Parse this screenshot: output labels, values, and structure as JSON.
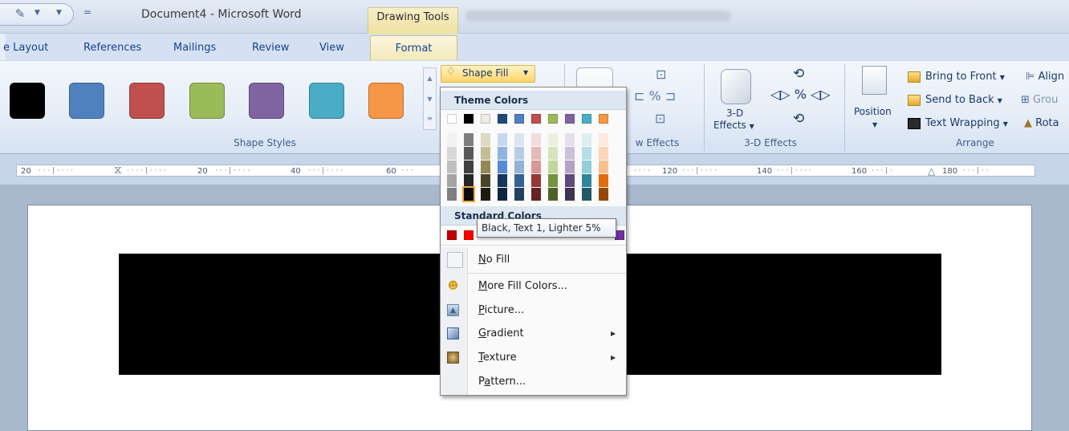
{
  "titlebar": {
    "title": "Document4 - Microsoft Word",
    "context_tab": "Drawing Tools",
    "customize_glyph": "="
  },
  "tabs": [
    "e Layout",
    "References",
    "Mailings",
    "Review",
    "View",
    "Format"
  ],
  "ribbon": {
    "shape_styles": {
      "label": "Shape Styles",
      "swatches": [
        "#000000",
        "#4f81bd",
        "#c0504d",
        "#9bbb59",
        "#8064a2",
        "#4bacc6",
        "#f79646"
      ]
    },
    "shape_fill": {
      "label": "Shape Fill",
      "icon": "paint-bucket-icon"
    },
    "shadow_effects": {
      "label": "w Effects"
    },
    "three_d": {
      "label": "3-D Effects",
      "button_line1": "3-D",
      "button_line2": "Effects"
    },
    "arrange": {
      "label": "Arrange",
      "position": "Position",
      "bring_to_front": "Bring to Front",
      "send_to_back": "Send to Back",
      "text_wrapping": "Text Wrapping",
      "align": "Align",
      "group": "Grou",
      "rotate": "Rota"
    }
  },
  "ruler": {
    "left_numbers": [
      "20",
      "20",
      "40",
      "60"
    ],
    "right_numbers": [
      "120",
      "140",
      "160",
      "180"
    ]
  },
  "dropdown": {
    "theme_header": "Theme Colors",
    "standard_header": "Standard Colors",
    "theme_top_row": [
      "#ffffff",
      "#000000",
      "#eeece1",
      "#1f497d",
      "#4f81bd",
      "#c0504d",
      "#9bbb59",
      "#8064a2",
      "#4bacc6",
      "#f79646"
    ],
    "theme_shades": [
      [
        "#f2f2f2",
        "#7f7f7f",
        "#ddd9c3",
        "#c6d9f0",
        "#dbe5f1",
        "#f2dcdb",
        "#ebf1dd",
        "#e5e0ec",
        "#dbeef3",
        "#fdeada"
      ],
      [
        "#d8d8d8",
        "#595959",
        "#c4bd97",
        "#8db3e2",
        "#b8cce4",
        "#e5b9b7",
        "#d7e3bc",
        "#ccc1d9",
        "#b7dde8",
        "#fbd5b5"
      ],
      [
        "#bfbfbf",
        "#3f3f3f",
        "#938953",
        "#548dd4",
        "#95b3d7",
        "#d99694",
        "#c3d69b",
        "#b2a2c7",
        "#92cddc",
        "#fac08f"
      ],
      [
        "#a5a5a5",
        "#262626",
        "#494429",
        "#17365d",
        "#366092",
        "#953734",
        "#76923c",
        "#5f497a",
        "#31859b",
        "#e36c09"
      ],
      [
        "#7f7f7f",
        "#0c0c0c",
        "#1d1b10",
        "#0f243e",
        "#244061",
        "#632423",
        "#4f6128",
        "#3f3151",
        "#205867",
        "#974806"
      ]
    ],
    "standard_visible": [
      "#c00000",
      "#ff0000"
    ],
    "standard_right": [
      "#7030a0"
    ],
    "tooltip": "Black, Text 1, Lighter 5%",
    "items": {
      "no_fill_u": "N",
      "no_fill_rest": "o Fill",
      "more_u": "M",
      "more_rest": "ore Fill Colors...",
      "picture_u": "P",
      "picture_rest": "icture...",
      "gradient_u": "G",
      "gradient_rest": "radient",
      "texture_u": "T",
      "texture_rest": "exture",
      "pattern_pre": "P",
      "pattern_u": "a",
      "pattern_rest": "ttern..."
    }
  }
}
